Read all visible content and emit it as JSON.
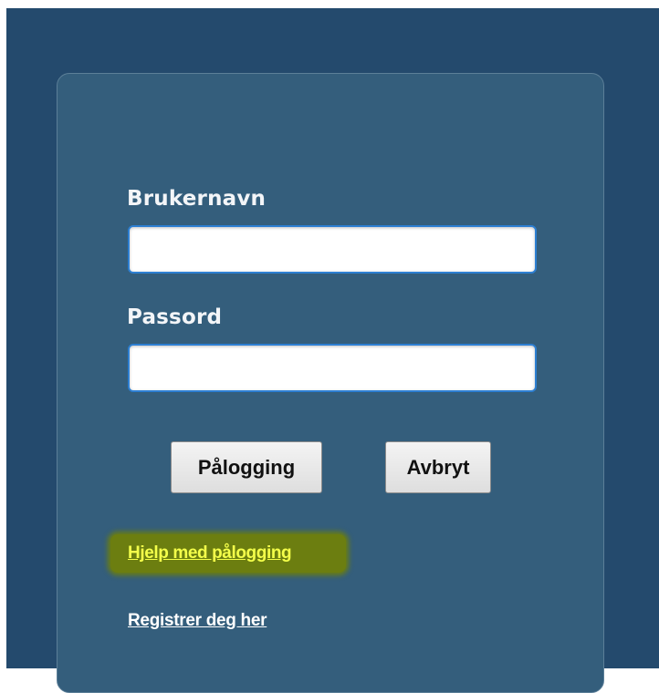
{
  "login_form": {
    "username_label": "Brukernavn",
    "username_value": "",
    "password_label": "Passord",
    "password_value": "",
    "login_button": "Pålogging",
    "cancel_button": "Avbryt"
  },
  "links": {
    "help_login": "Hjelp med pålogging",
    "register": "Registrer deg her"
  },
  "colors": {
    "page_background": "#244a6d",
    "panel_background": "#345e7c",
    "help_link_text": "#f4ff4a",
    "help_link_highlight": "#6c7e10",
    "input_border_focus": "#2d7fd2"
  }
}
